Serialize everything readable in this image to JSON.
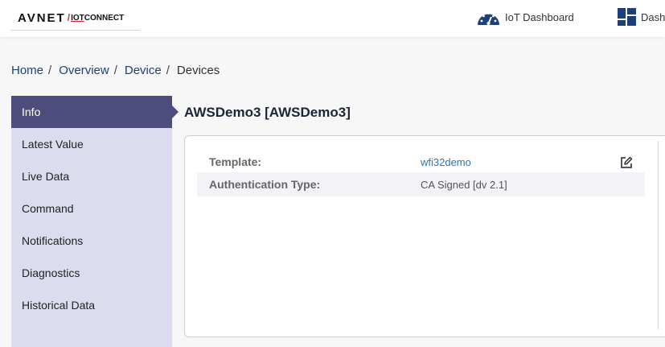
{
  "header": {
    "logo": {
      "brand": "AVNET",
      "sep": "/",
      "iot": "IOT",
      "connect": "CONNECT"
    },
    "nav": [
      {
        "label": "IoT Dashboard",
        "icon": "speedometer-icon"
      },
      {
        "label": "Dash",
        "icon": "dashboard-grid-icon"
      }
    ]
  },
  "breadcrumb": [
    "Home",
    "Overview",
    "Device",
    "Devices"
  ],
  "breadcrumb_sep": "/",
  "sidebar": {
    "items": [
      {
        "label": "Info",
        "active": true
      },
      {
        "label": "Latest Value"
      },
      {
        "label": "Live Data"
      },
      {
        "label": "Command"
      },
      {
        "label": "Notifications"
      },
      {
        "label": "Diagnostics"
      },
      {
        "label": "Historical Data"
      }
    ]
  },
  "main": {
    "title": "AWSDemo3 [AWSDemo3]",
    "fields": [
      {
        "label": "Template:",
        "value": "wfi32demo"
      },
      {
        "label": "Authentication Type:",
        "value": "CA Signed [dv 2.1]"
      }
    ]
  },
  "colors": {
    "accent": "#4d4c7d",
    "sidebar_bg": "#dcdcef",
    "link": "#1f3f7a",
    "value_link": "#2b74b8",
    "icon_blue": "#1f3f7a"
  }
}
